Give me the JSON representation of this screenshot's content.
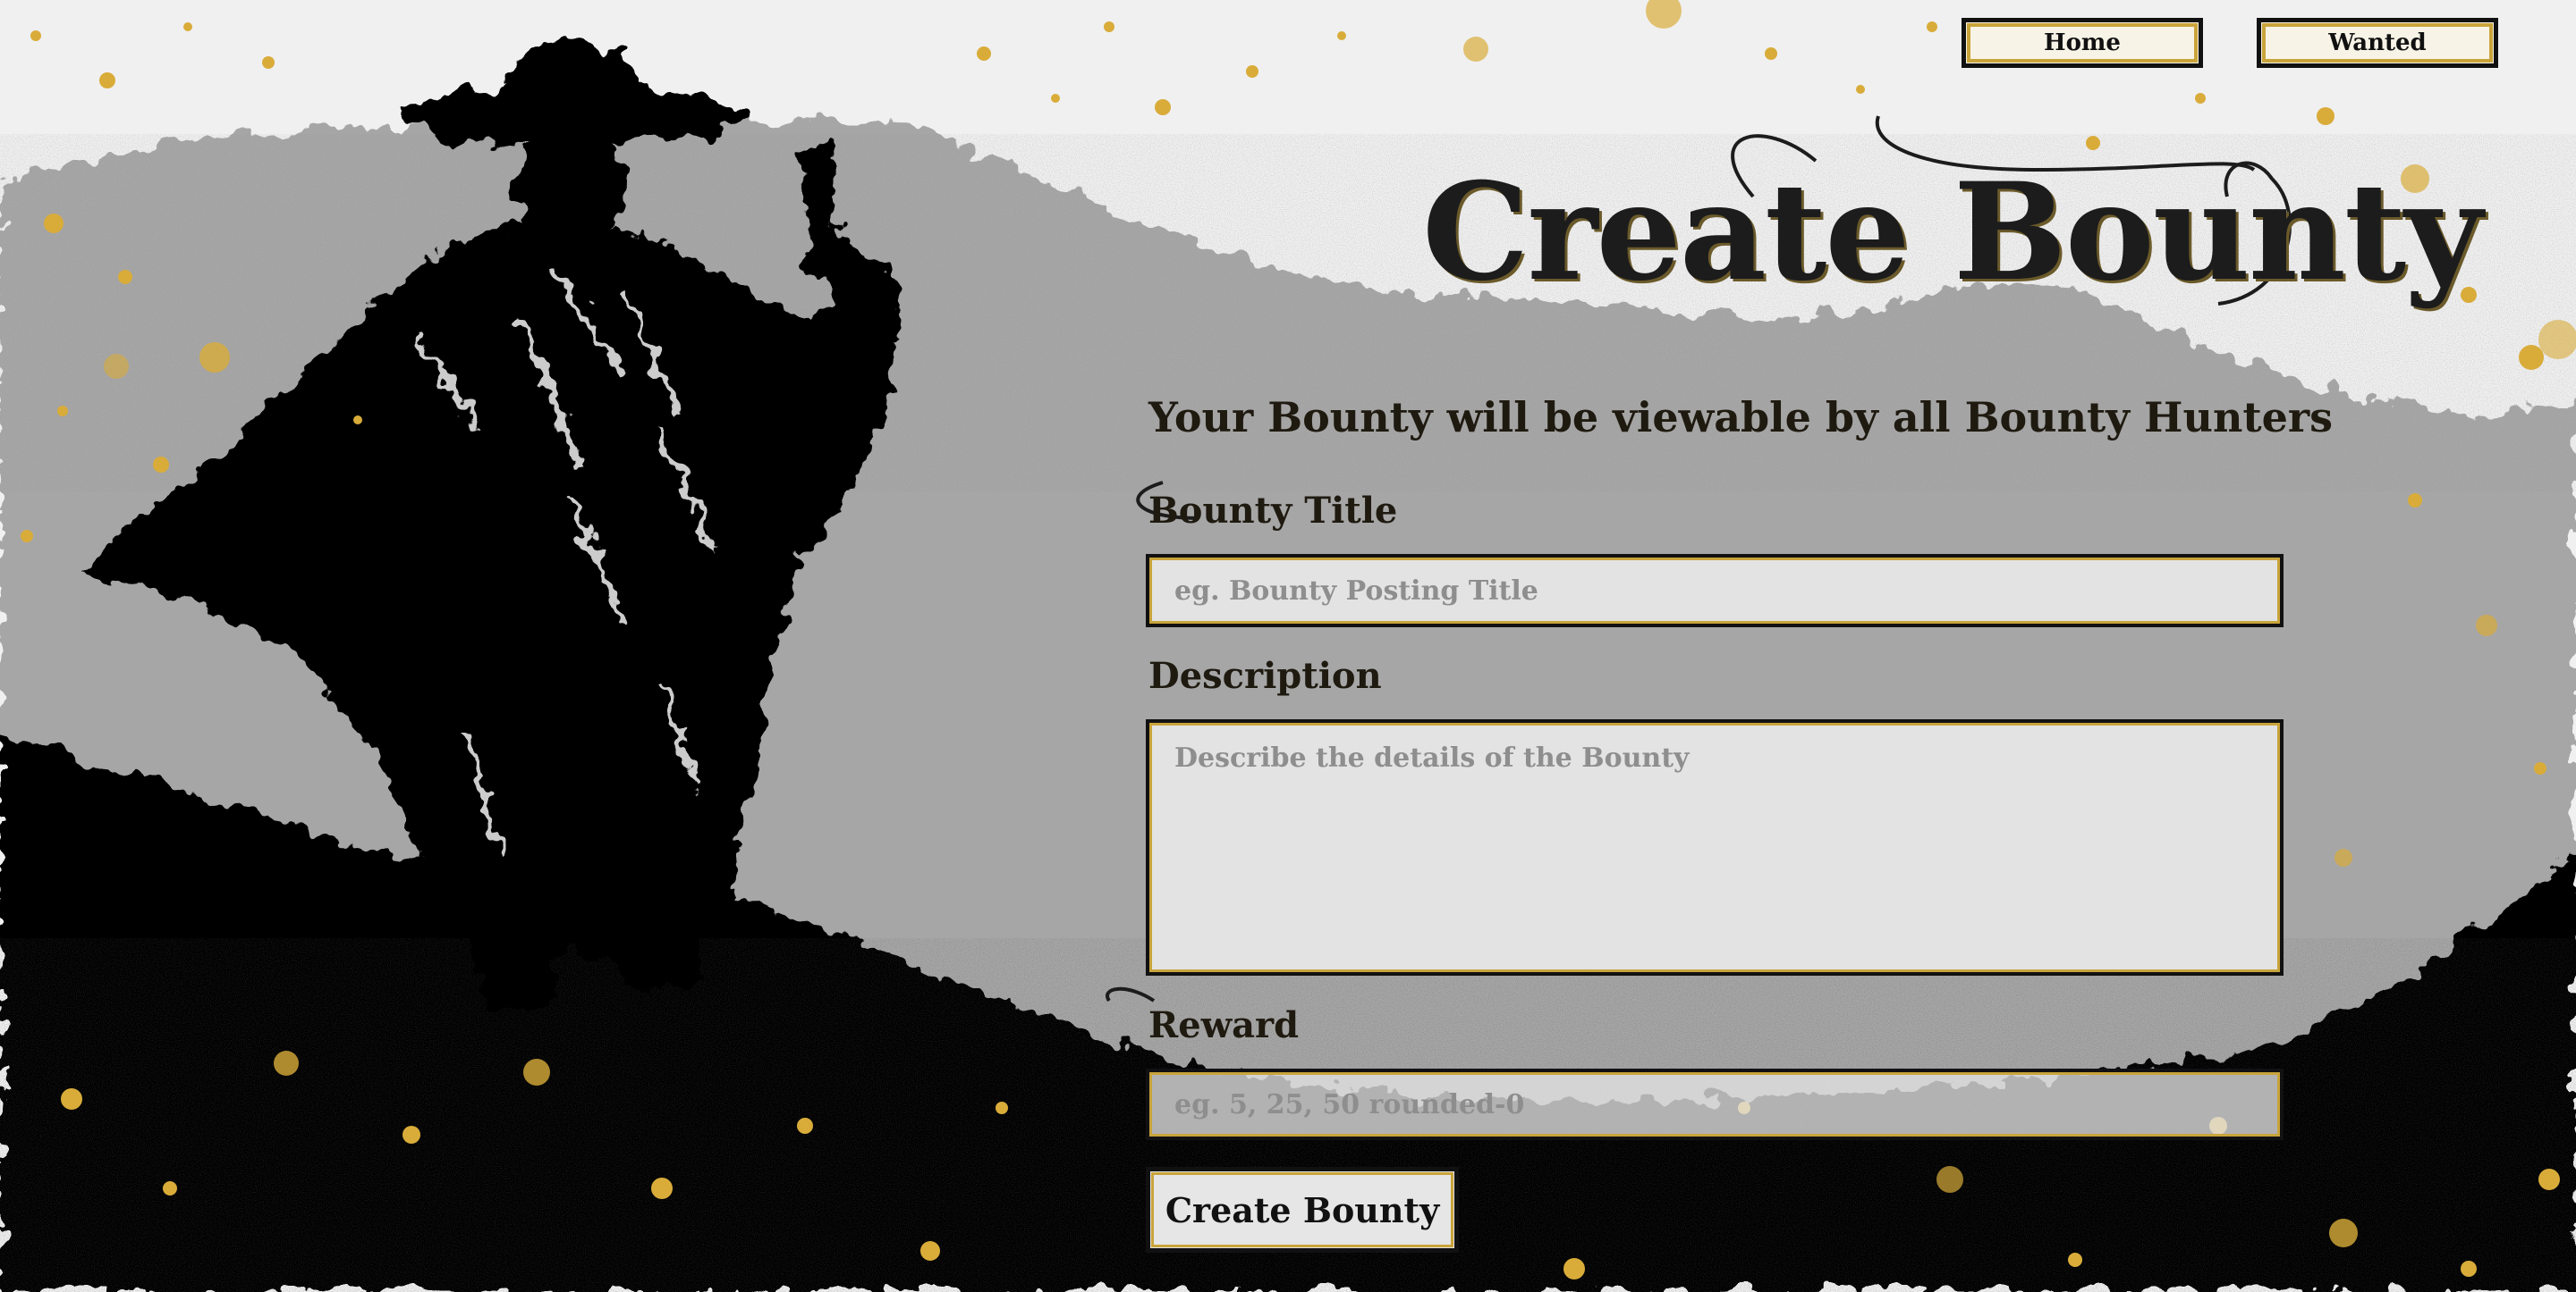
{
  "nav": {
    "home_label": "Home",
    "wanted_label": "Wanted"
  },
  "page": {
    "title": "Create Bounty",
    "subtitle": "Your Bounty will be viewable by all Bounty Hunters"
  },
  "form": {
    "title_label": "Bounty Title",
    "title_placeholder": "eg. Bounty Posting Title",
    "description_label": "Description",
    "description_placeholder": "Describe the details of the Bounty",
    "reward_label": "Reward",
    "reward_placeholder": "eg. 5, 25, 50 rounded-0",
    "submit_label": "Create Bounty"
  },
  "theme": {
    "gold": "#c9a43b",
    "ink": "#111111",
    "sky": "#f0f0f0",
    "mid_gray": "#a6a6a6",
    "field_bg": "#e3e3e3"
  },
  "illustration": {
    "subject": "cowboy-silhouette-with-revolver",
    "style": "black-white-gray ink splatter with gold speckles"
  }
}
